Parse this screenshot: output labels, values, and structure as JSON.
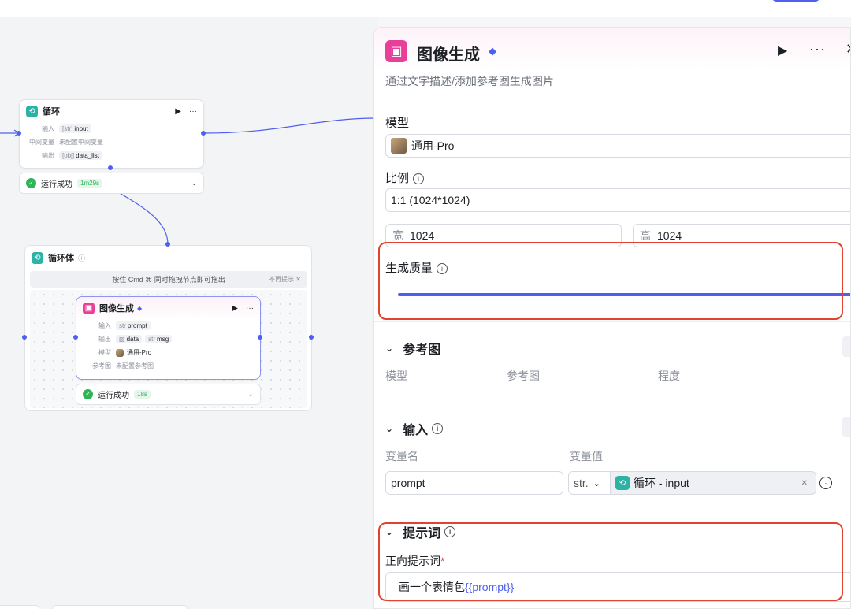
{
  "canvas": {
    "loop_node": {
      "title": "循环",
      "input_label": "输入",
      "input_type": "[str]",
      "input_value": "input",
      "mid_label": "中间变量",
      "mid_value": "未配置中间变量",
      "output_label": "输出",
      "output_type": "[obj]",
      "output_value": "data_list",
      "status": "运行成功",
      "duration": "1m29s"
    },
    "loop_body": {
      "title": "循环体",
      "hint": "按住 Cmd ⌘ 同时拖拽节点即可拖出",
      "hint_dismiss": "不再提示",
      "image_node": {
        "title": "图像生成",
        "input_label": "输入",
        "input_type": "str",
        "input_value": "prompt",
        "output_label": "输出",
        "output_value_1": "data",
        "output_type_2": "str",
        "output_value_2": "msg",
        "model_label": "模型",
        "model_value": "通用-Pro",
        "ref_label": "参考图",
        "ref_value": "未配置参考图",
        "status": "运行成功",
        "duration": "18s"
      }
    }
  },
  "panel": {
    "title": "图像生成",
    "description": "通过文字描述/添加参考图生成图片",
    "model_label": "模型",
    "model_value": "通用-Pro",
    "ratio_label": "比例",
    "ratio_value": "1:1 (1024*1024)",
    "width_label": "宽",
    "width_value": "1024",
    "height_label": "高",
    "height_value": "1024",
    "quality_label": "生成质量",
    "reference_section": {
      "title": "参考图",
      "col_model": "模型",
      "col_ref": "参考图",
      "col_degree": "程度"
    },
    "input_section": {
      "title": "输入",
      "col_name": "变量名",
      "col_value": "变量值",
      "var_name": "prompt",
      "var_type": "str.",
      "var_ref": "循环 - input"
    },
    "prompt_section": {
      "title": "提示词",
      "positive_label": "正向提示词",
      "required_mark": "*",
      "prompt_text": "画一个表情包",
      "prompt_var": "{{prompt}}"
    }
  },
  "colors": {
    "accent": "#4e5ff0",
    "highlight": "#e0432f",
    "success": "#2fb457",
    "loop_icon": "#2eb2a4",
    "image_icon": "#e8409a"
  }
}
